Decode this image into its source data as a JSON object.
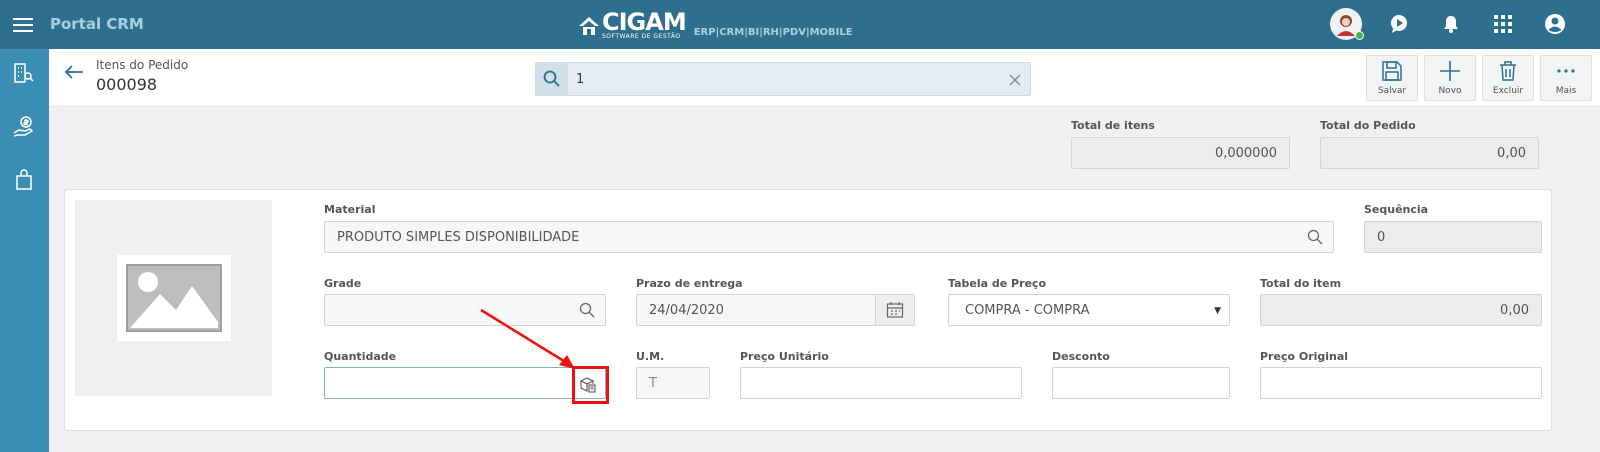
{
  "app": {
    "title": "Portal CRM",
    "brand": "CIGAM",
    "brand_sub": "SOFTWARE DE GESTÃO",
    "brand_links": "ERP|CRM|BI|RH|PDV|MOBILE"
  },
  "header": {
    "subtitle": "Itens do Pedido",
    "title": "000098",
    "search_value": "1"
  },
  "actions": [
    {
      "label": "Salvar",
      "icon": "save-icon"
    },
    {
      "label": "Novo",
      "icon": "plus-icon"
    },
    {
      "label": "Excluir",
      "icon": "trash-icon"
    },
    {
      "label": "Mais",
      "icon": "more-icon"
    }
  ],
  "totals": {
    "items_label": "Total de itens",
    "items_value": "0,000000",
    "order_label": "Total do Pedido",
    "order_value": "0,00"
  },
  "form": {
    "material_label": "Material",
    "material_value": "PRODUTO SIMPLES DISPONIBILIDADE",
    "sequence_label": "Sequência",
    "sequence_value": "0",
    "grade_label": "Grade",
    "grade_value": "",
    "delivery_label": "Prazo de entrega",
    "delivery_value": "24/04/2020",
    "price_table_label": "Tabela de Preço",
    "price_table_value": "COMPRA - COMPRA",
    "item_total_label": "Total do item",
    "item_total_value": "0,00",
    "quantity_label": "Quantidade",
    "quantity_value": "",
    "um_label": "U.M.",
    "um_value": "T",
    "unit_price_label": "Preço Unitário",
    "unit_price_value": "",
    "discount_label": "Desconto",
    "discount_value": "",
    "original_price_label": "Preço Original",
    "original_price_value": ""
  },
  "colors": {
    "topbar": "#2e6f8f",
    "sidebar": "#3b8db3",
    "highlight": "#e11111"
  }
}
